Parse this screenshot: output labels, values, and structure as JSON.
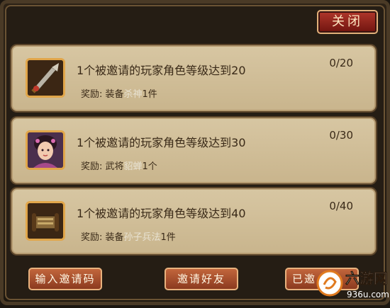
{
  "header": {
    "close_label": "关闭"
  },
  "tasks": [
    {
      "title": "1个被邀请的玩家角色等级达到20",
      "reward_prefix": "奖励: 装备",
      "reward_item": "杀神",
      "reward_suffix": "1件",
      "progress": "0/20",
      "icon": "blade-weapon-icon"
    },
    {
      "title": "1个被邀请的玩家角色等级达到30",
      "reward_prefix": "奖励: 武将",
      "reward_item": "貂蝉",
      "reward_suffix": "1个",
      "progress": "0/30",
      "icon": "diaochan-portrait-icon"
    },
    {
      "title": "1个被邀请的玩家角色等级达到40",
      "reward_prefix": "奖励: 装备",
      "reward_item": "孙子兵法",
      "reward_suffix": "1件",
      "progress": "0/40",
      "icon": "scroll-book-icon"
    }
  ],
  "footer": {
    "enter_code_label": "输入邀请码",
    "invite_friend_label": "邀请好友",
    "invited_label": "已邀"
  },
  "watermark": {
    "brand": "六游网",
    "url": "936u.com"
  },
  "colors": {
    "card_bg": "#d7c6a2",
    "close_button": "#b1372b",
    "action_button": "#c2663c",
    "highlight_item": "#e8e2d2"
  }
}
